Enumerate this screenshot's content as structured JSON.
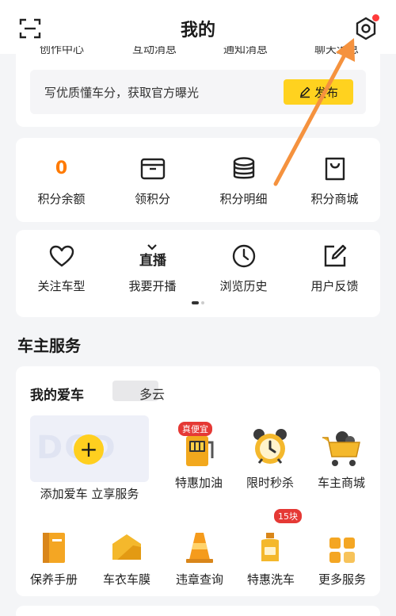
{
  "header": {
    "title": "我的",
    "scan_icon": "scan-icon",
    "settings_icon": "gear-icon"
  },
  "messages": {
    "tabs": [
      "创作中心",
      "互动消息",
      "通知消息",
      "聊天消息"
    ],
    "promo_text": "写优质懂车分，获取官方曝光",
    "publish_label": "发布"
  },
  "points": {
    "balance_value": "0",
    "items": [
      {
        "label": "积分余额"
      },
      {
        "label": "领积分",
        "icon": "box-icon"
      },
      {
        "label": "积分明细",
        "icon": "coins-icon"
      },
      {
        "label": "积分商城",
        "icon": "shopping-bag-icon"
      }
    ]
  },
  "quick": {
    "items": [
      {
        "label": "关注车型",
        "icon": "heart-icon"
      },
      {
        "label": "我要开播",
        "icon": "live-icon"
      },
      {
        "label": "浏览历史",
        "icon": "clock-icon"
      },
      {
        "label": "用户反馈",
        "icon": "edit-icon"
      }
    ]
  },
  "owner_services": {
    "section_title": "车主服务",
    "my_car_title": "我的爱车",
    "car_name": "多云",
    "add_car_label": "添加爱车 立享服务",
    "row1": [
      {
        "label": "特惠加油",
        "badge": "真便宜",
        "icon": "fuel-pump-icon"
      },
      {
        "label": "限时秒杀",
        "icon": "alarm-clock-icon"
      },
      {
        "label": "车主商城",
        "icon": "shopping-cart-icon"
      }
    ],
    "row2": [
      {
        "label": "保养手册",
        "icon": "manual-icon"
      },
      {
        "label": "车衣车膜",
        "icon": "car-cover-icon"
      },
      {
        "label": "违章查询",
        "icon": "traffic-cone-icon"
      },
      {
        "label": "特惠洗车",
        "badge": "15块",
        "icon": "wash-bottle-icon"
      },
      {
        "label": "更多服务",
        "icon": "grid-icon"
      }
    ]
  },
  "colors": {
    "accent_yellow": "#ffd21f",
    "points_orange": "#ff7a00",
    "badge_red": "#e53935",
    "annotation_arrow": "#f5923e"
  }
}
